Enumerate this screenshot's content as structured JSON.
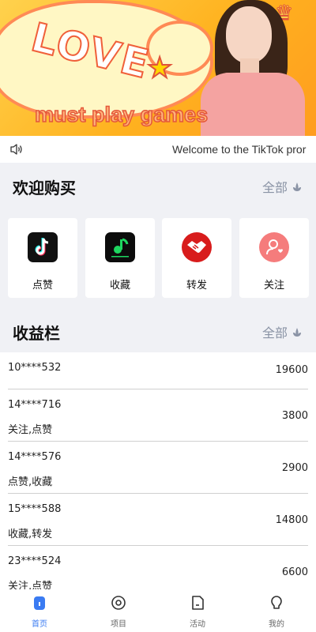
{
  "banner": {
    "title": "LOVE",
    "tagline": "must play games"
  },
  "notice": {
    "text": "Welcome to the TikTok pror"
  },
  "welcome_section": {
    "title": "欢迎购买",
    "more_label": "全部"
  },
  "features": [
    {
      "label": "点赞",
      "icon": "tiktok-icon"
    },
    {
      "label": "收藏",
      "icon": "music-app-icon"
    },
    {
      "label": "转发",
      "icon": "handshake-icon"
    },
    {
      "label": "关注",
      "icon": "follow-user-icon"
    }
  ],
  "earnings_section": {
    "title": "收益栏",
    "more_label": "全部"
  },
  "earnings": [
    {
      "id": "10****532",
      "desc": "",
      "amount": "19600"
    },
    {
      "id": "14****716",
      "desc": "关注,点赞",
      "amount": "3800"
    },
    {
      "id": "14****576",
      "desc": "点赞,收藏",
      "amount": "2900"
    },
    {
      "id": "15****588",
      "desc": "收藏,转发",
      "amount": "14800"
    },
    {
      "id": "23****524",
      "desc": "关注,点赞",
      "amount": "6600"
    }
  ],
  "tabs": [
    {
      "label": "首页",
      "icon": "home-icon",
      "active": true
    },
    {
      "label": "项目",
      "icon": "project-icon",
      "active": false
    },
    {
      "label": "活动",
      "icon": "activity-icon",
      "active": false
    },
    {
      "label": "我的",
      "icon": "profile-icon",
      "active": false
    }
  ],
  "colors": {
    "accent": "#3a7bf2",
    "muted": "#8a93a5"
  }
}
